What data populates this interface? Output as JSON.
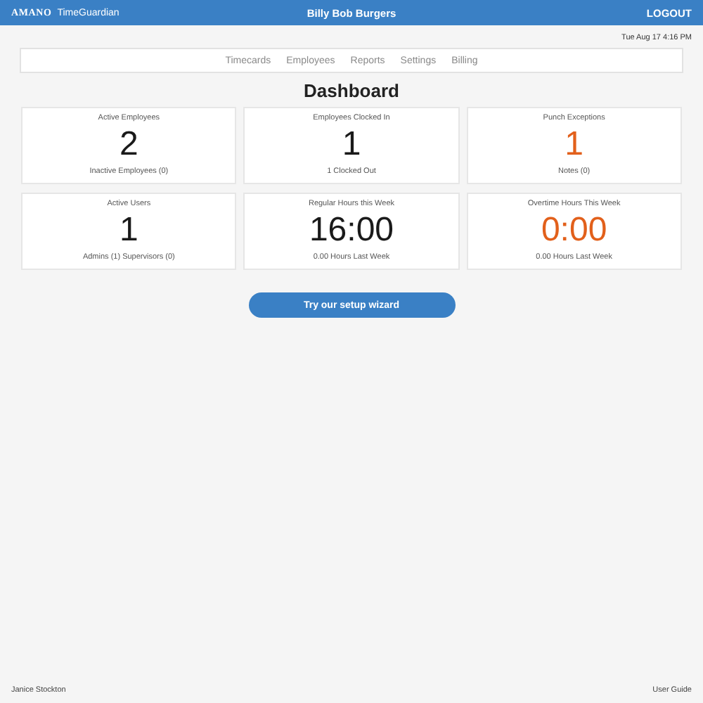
{
  "header": {
    "brand": "AMANO",
    "product": "TimeGuardian",
    "company": "Billy Bob Burgers",
    "logout": "LOGOUT"
  },
  "datetime": "Tue Aug 17 4:16 PM",
  "nav": [
    {
      "label": "Timecards"
    },
    {
      "label": "Employees"
    },
    {
      "label": "Reports"
    },
    {
      "label": "Settings"
    },
    {
      "label": "Billing"
    }
  ],
  "title": "Dashboard",
  "cards": [
    {
      "label": "Active Employees",
      "value": "2",
      "alert": false,
      "sub": "Inactive Employees (0)"
    },
    {
      "label": "Employees Clocked In",
      "value": "1",
      "alert": false,
      "sub": "1 Clocked Out"
    },
    {
      "label": "Punch Exceptions",
      "value": "1",
      "alert": true,
      "sub": "Notes (0)"
    },
    {
      "label": "Active Users",
      "value": "1",
      "alert": false,
      "sub": "Admins (1)  Supervisors (0)"
    },
    {
      "label": "Regular Hours this Week",
      "value": "16:00",
      "alert": false,
      "sub": "0.00 Hours Last Week"
    },
    {
      "label": "Overtime Hours This Week",
      "value": "0:00",
      "alert": true,
      "sub": "0.00 Hours Last Week"
    }
  ],
  "wizard_button": "Try our setup wizard",
  "footer": {
    "user": "Janice Stockton",
    "guide": "User Guide"
  }
}
